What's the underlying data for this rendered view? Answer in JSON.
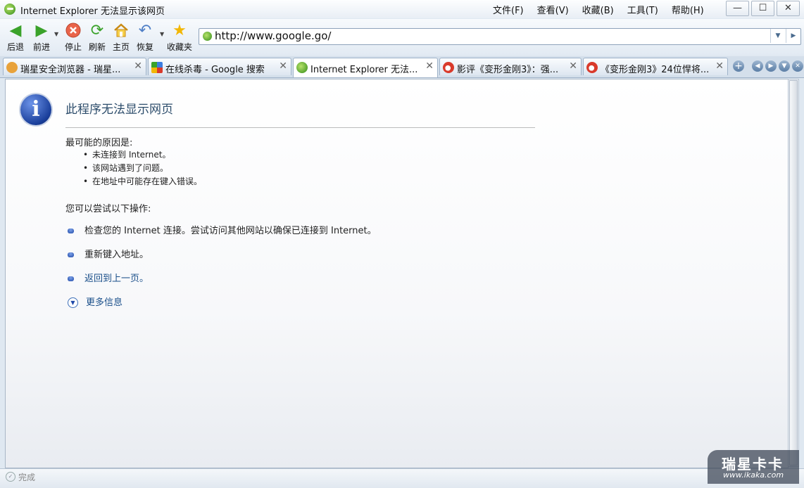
{
  "window": {
    "title": "Internet Explorer 无法显示该网页"
  },
  "menu": [
    "文件(F)",
    "查看(V)",
    "收藏(B)",
    "工具(T)",
    "帮助(H)"
  ],
  "window_buttons": [
    "—",
    "☐",
    "✕"
  ],
  "toolbar": {
    "back": "后退",
    "forward": "前进",
    "stop": "停止",
    "refresh": "刷新",
    "home": "主页",
    "restore": "恢复",
    "favorites": "收藏夹"
  },
  "address": {
    "url": "http://www.google.go/"
  },
  "tabs": [
    {
      "title": "瑞星安全浏览器 - 瑞星...",
      "icon": "rising-browser-icon",
      "color": "#e8a23a"
    },
    {
      "title": "在线杀毒 - Google 搜索",
      "icon": "google-icon",
      "color": "#3b7de0"
    },
    {
      "title": "Internet Explorer 无法...",
      "icon": "ie-page-icon",
      "color": "#3a9a24",
      "active": true
    },
    {
      "title": "影评《变形金刚3》：强...",
      "icon": "weibo-icon",
      "color": "#d93a2b"
    },
    {
      "title": "《变形金刚3》24位悍将...",
      "icon": "weibo-icon",
      "color": "#d93a2b"
    }
  ],
  "page": {
    "heading": "此程序无法显示网页",
    "cause_title": "最可能的原因是:",
    "causes": [
      "未连接到 Internet。",
      "该网站遇到了问题。",
      "在地址中可能存在键入错误。"
    ],
    "try_title": "您可以尝试以下操作:",
    "actions": [
      "检查您的 Internet 连接。尝试访问其他网站以确保已连接到 Internet。",
      "重新键入地址。",
      "返回到上一页。"
    ],
    "more_info": "更多信息"
  },
  "status": {
    "text": "完成"
  },
  "watermark": {
    "logo": "瑞星卡卡",
    "url": "www.ikaka.com"
  }
}
